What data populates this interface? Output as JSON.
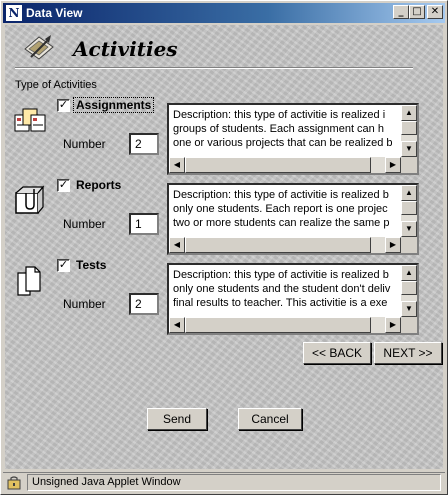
{
  "window": {
    "title": "Data View",
    "minimize": "_",
    "maximize": "□",
    "close": "✕"
  },
  "header": {
    "title": "Activities"
  },
  "section_label": "Type of Activities",
  "groups": [
    {
      "icon": "assignments-icon",
      "checked": true,
      "label": "Assignments",
      "number_label": "Number",
      "number_value": "2",
      "description_lines": [
        "Description:  this type of activitie is realized i",
        "groups of students. Each assignment can h",
        "one or various projects that can be realized b"
      ]
    },
    {
      "icon": "reports-icon",
      "checked": true,
      "label": "Reports",
      "number_label": "Number",
      "number_value": "1",
      "description_lines": [
        "Description:  this type of activitie is realized b",
        "only one students. Each report is one projec",
        "two or more students can realize the same p"
      ]
    },
    {
      "icon": "tests-icon",
      "checked": true,
      "label": "Tests",
      "number_label": "Number",
      "number_value": "2",
      "description_lines": [
        "Description:  this type of activitie is realized b",
        "only one students and the student don't deliv",
        "final results to teacher. This activitie is a exe"
      ]
    }
  ],
  "nav": {
    "back": "<< BACK",
    "next": "NEXT >>"
  },
  "actions": {
    "send": "Send",
    "cancel": "Cancel"
  },
  "status": {
    "text": "Unsigned Java Applet Window"
  }
}
